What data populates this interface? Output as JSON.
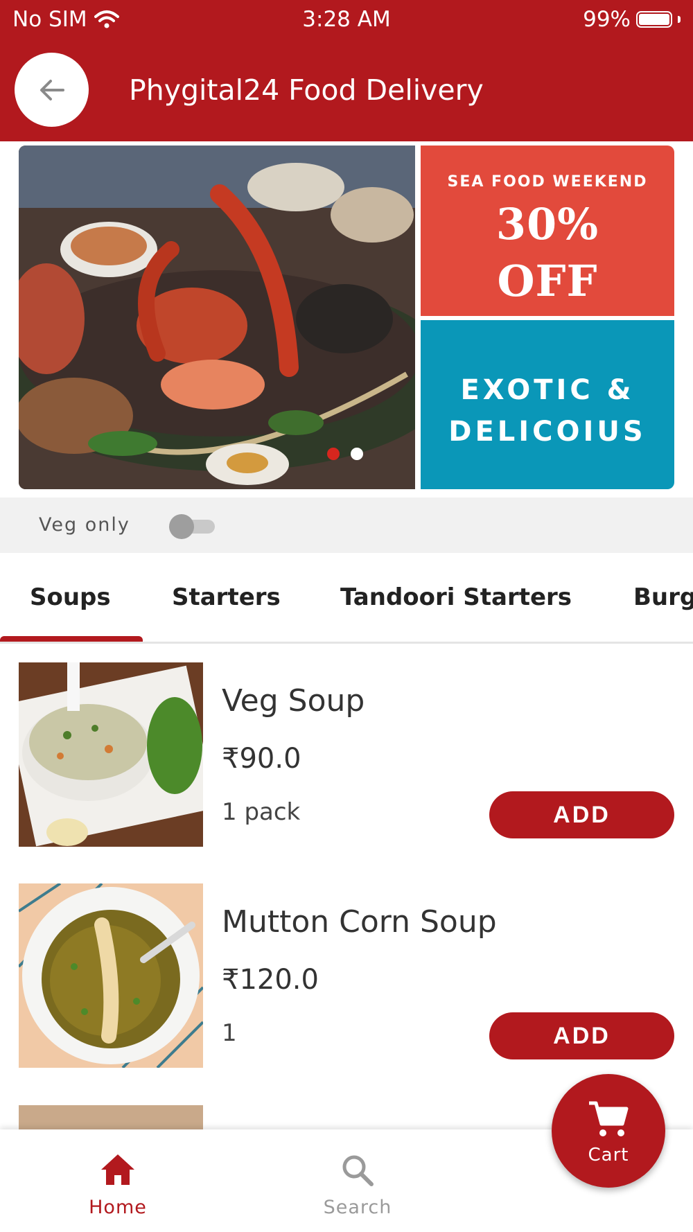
{
  "status_bar": {
    "carrier": "No SIM",
    "time": "3:28 AM",
    "battery_text": "99%",
    "battery_level": 0.99
  },
  "app_bar": {
    "title": "Phygital24 Food Delivery",
    "back_icon": "arrow-left-icon"
  },
  "banner": {
    "promo_kicker": "SEA FOOD WEEKEND",
    "promo_big_line1": "30%",
    "promo_big_line2": "OFF",
    "tagline_line1": "EXOTIC &",
    "tagline_line2": "DELICOIUS",
    "slides_count": 2,
    "active_slide": 1
  },
  "filter": {
    "veg_only_label": "Veg only",
    "veg_only_on": false
  },
  "categories": {
    "tabs": [
      "Soups",
      "Starters",
      "Tandoori Starters",
      "Burg"
    ],
    "active_index": 0
  },
  "products": [
    {
      "name": "Veg Soup",
      "price": "₹90.0",
      "unit": "1 pack",
      "add_label": "ADD"
    },
    {
      "name": "Mutton Corn Soup",
      "price": "₹120.0",
      "unit": "1",
      "add_label": "ADD"
    }
  ],
  "bottom_nav": {
    "home_label": "Home",
    "search_label": "Search",
    "cart_label": "Cart",
    "active": "Home"
  },
  "colors": {
    "brand": "#b2191e",
    "promo_red": "#e24a3c",
    "promo_blue": "#0a97b8"
  }
}
